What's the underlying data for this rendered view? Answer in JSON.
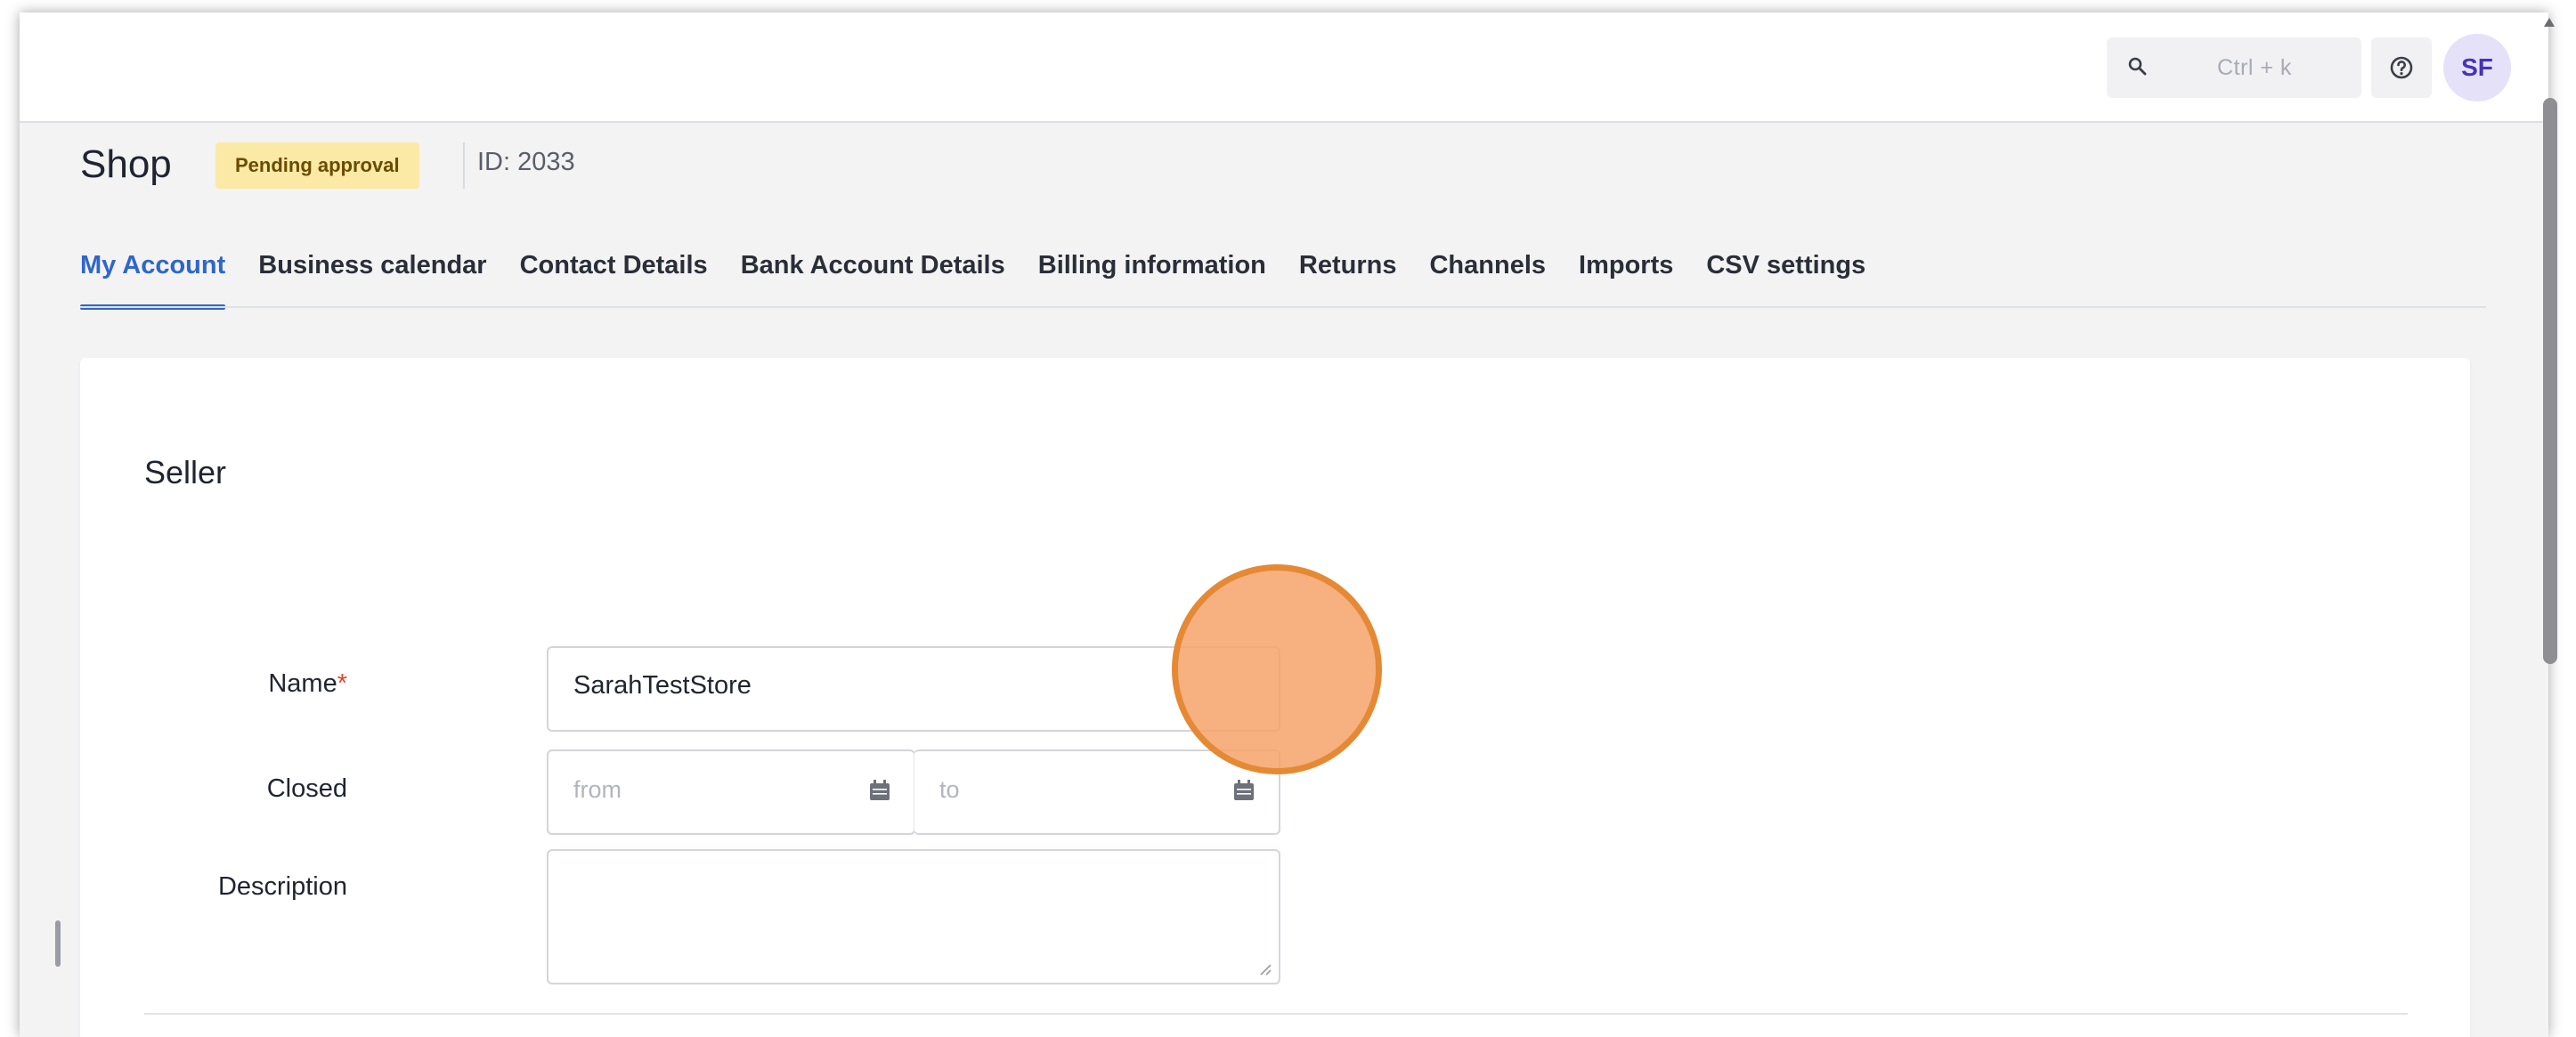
{
  "topbar": {
    "search_shortcut": "Ctrl + k",
    "avatar_initials": "SF"
  },
  "header": {
    "title": "Shop",
    "status_badge": "Pending approval",
    "id_text": "ID: 2033"
  },
  "tabs": [
    {
      "label": "My Account",
      "active": true
    },
    {
      "label": "Business calendar"
    },
    {
      "label": "Contact Details"
    },
    {
      "label": "Bank Account Details"
    },
    {
      "label": "Billing information"
    },
    {
      "label": "Returns"
    },
    {
      "label": "Channels"
    },
    {
      "label": "Imports"
    },
    {
      "label": "CSV settings"
    }
  ],
  "seller": {
    "section_title": "Seller",
    "name_label": "Name",
    "name_required": "*",
    "name_value": "SarahTestStore",
    "closed_label": "Closed",
    "closed_from_placeholder": "from",
    "closed_to_placeholder": "to",
    "description_label": "Description",
    "description_value": ""
  },
  "colors": {
    "accent": "#2f67c8",
    "badge_bg": "#fbe9a6",
    "avatar_bg": "#e5e1f8",
    "click_marker": "#f5a064"
  },
  "icons": [
    "search-icon",
    "help-icon",
    "calendar-icon",
    "resize-grip-icon"
  ]
}
